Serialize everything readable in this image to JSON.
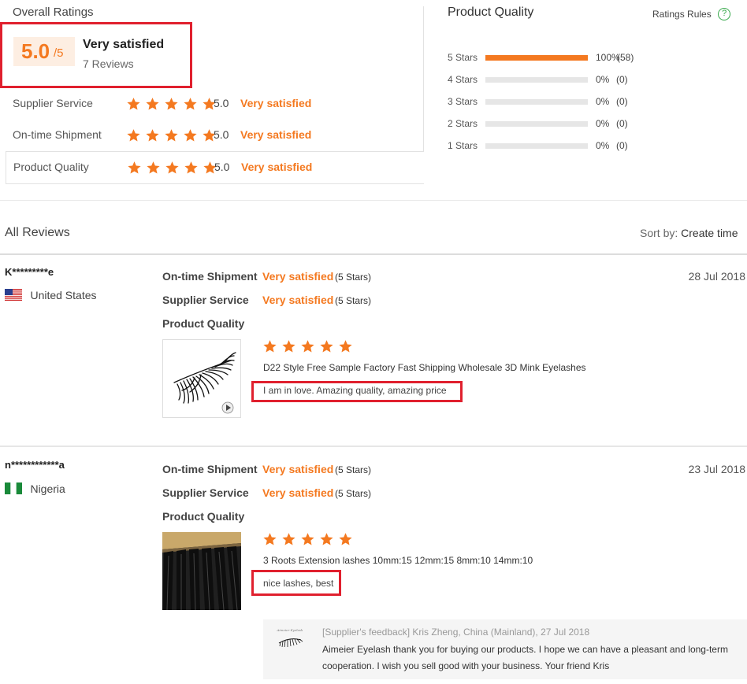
{
  "overall": {
    "title": "Overall Ratings",
    "score": "5.0",
    "out_of": "/5",
    "verdict": "Very satisfied",
    "reviews": "7 Reviews",
    "rows": [
      {
        "label": "Supplier Service",
        "score": "5.0",
        "verdict": "Very satisfied",
        "stars": 5
      },
      {
        "label": "On-time Shipment",
        "score": "5.0",
        "verdict": "Very satisfied",
        "stars": 5
      },
      {
        "label": "Product Quality",
        "score": "5.0",
        "verdict": "Very satisfied",
        "stars": 5
      }
    ]
  },
  "quality": {
    "title": "Product Quality",
    "rules_label": "Ratings Rules",
    "rules_icon": "help-circle-icon",
    "bars": [
      {
        "label": "5 Stars",
        "percent": "100%",
        "count": "(58)",
        "fill": 1.0
      },
      {
        "label": "4 Stars",
        "percent": "0%",
        "count": "(0)",
        "fill": 0
      },
      {
        "label": "3 Stars",
        "percent": "0%",
        "count": "(0)",
        "fill": 0
      },
      {
        "label": "2 Stars",
        "percent": "0%",
        "count": "(0)",
        "fill": 0
      },
      {
        "label": "1 Stars",
        "percent": "0%",
        "count": "(0)",
        "fill": 0
      }
    ]
  },
  "reviews_header": {
    "title": "All Reviews",
    "sort_prefix": "Sort by:",
    "sort_value": "Create time"
  },
  "reviews": [
    {
      "user": "K*********e",
      "country": "United States",
      "flag": "us-flag-icon",
      "date": "28 Jul 2018",
      "shipment_label": "On-time Shipment",
      "shipment_verdict": "Very satisfied",
      "shipment_stars": "(5 Stars)",
      "service_label": "Supplier Service",
      "service_verdict": "Very satisfied",
      "service_stars": "(5 Stars)",
      "quality_label": "Product Quality",
      "product_stars": 5,
      "product_title": "D22 Style Free Sample Factory Fast Shipping Wholesale 3D Mink Eyelashes",
      "comment": "I am in love. Amazing quality, amazing price"
    },
    {
      "user": "n************a",
      "country": "Nigeria",
      "flag": "nigeria-flag-icon",
      "date": "23 Jul 2018",
      "shipment_label": "On-time Shipment",
      "shipment_verdict": "Very satisfied",
      "shipment_stars": "(5 Stars)",
      "service_label": "Supplier Service",
      "service_verdict": "Very satisfied",
      "service_stars": "(5 Stars)",
      "quality_label": "Product Quality",
      "product_stars": 5,
      "product_title": "3 Roots Extension lashes 10mm:15 12mm:15 8mm:10 14mm:10",
      "comment": "nice lashes, best",
      "feedback_meta": "[Supplier's feedback] Kris Zheng, China (Mainland), 27 Jul 2018",
      "feedback_line1": "Aimeier Eyelash thank you for buying our products. I hope we can have a pleasant and long-term",
      "feedback_line2": "cooperation. I wish you sell good with your business. Your friend Kris"
    }
  ],
  "colors": {
    "accent": "#f47920",
    "highlight": "#e0202e",
    "score_bg": "#fdeee2"
  }
}
